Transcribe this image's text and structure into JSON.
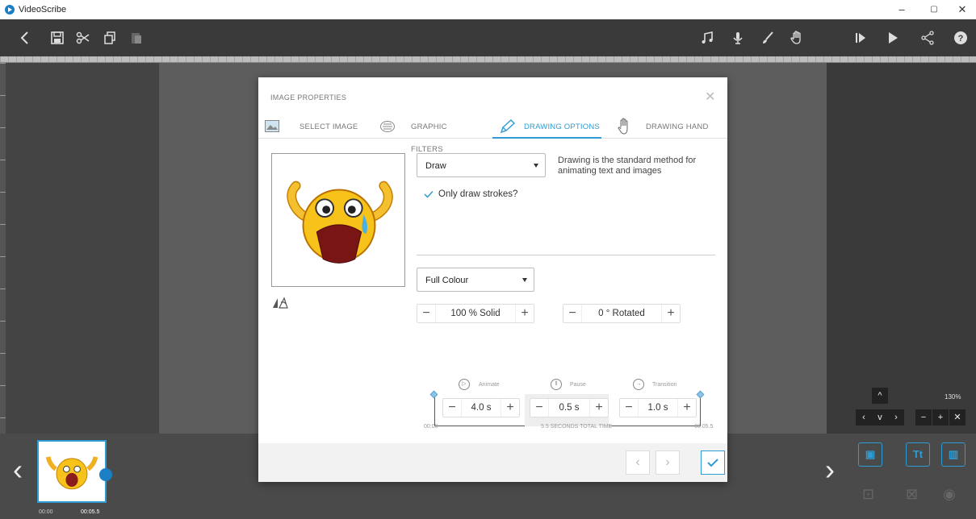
{
  "app": {
    "title": "VideoScribe"
  },
  "window_controls": {
    "minimize": "–",
    "restore": "▢",
    "close": "✕"
  },
  "dialog": {
    "title": "IMAGE PROPERTIES",
    "tabs": [
      {
        "label": "SELECT IMAGE",
        "icon": "image-icon"
      },
      {
        "label": "GRAPHIC FILTERS",
        "icon": "filter-icon"
      },
      {
        "label": "DRAWING OPTIONS",
        "icon": "pencil-icon",
        "active": true
      },
      {
        "label": "DRAWING HAND",
        "icon": "hand-icon"
      }
    ],
    "draw_mode": "Draw",
    "draw_description": "Drawing is the standard method for animating text and images",
    "only_draw_strokes_label": "Only draw strokes?",
    "only_draw_strokes_checked": true,
    "colour_mode": "Full Colour",
    "opacity_value": "100 % Solid",
    "rotation_value": "0 ° Rotated",
    "timing": {
      "animate_label": "Animate",
      "animate_value": "4.0 s",
      "pause_label": "Pause",
      "pause_value": "0.5 s",
      "transition_label": "Transition",
      "transition_value": "1.0 s",
      "start_time": "00:00",
      "total_label": "5.5 SECONDS TOTAL TIME",
      "end_time": "00:05.5"
    }
  },
  "timeline": {
    "thumb_start": "00:00",
    "thumb_end": "00:05.5",
    "zoom": "130%"
  },
  "colors": {
    "accent": "#2f9bd3",
    "toolbar": "#3a3a3a"
  }
}
